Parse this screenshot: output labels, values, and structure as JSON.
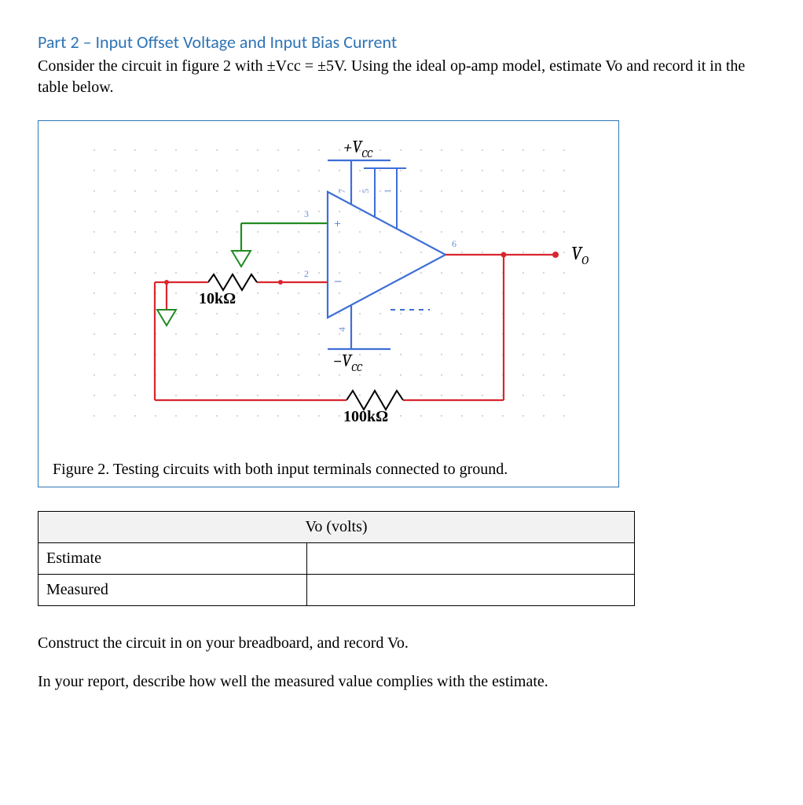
{
  "heading": "Part 2 – Input Offset Voltage and Input Bias Current",
  "prompt": "Consider the circuit in figure 2 with ±Vcc = ±5V. Using the ideal op-amp model, estimate Vo and record it in the table below.",
  "figure": {
    "labels": {
      "vcc_pos": "+V",
      "vcc_pos_sub": "CC",
      "vcc_neg": "−V",
      "vcc_neg_sub": "CC",
      "vo": "V",
      "vo_sub": "O",
      "r1": "10kΩ",
      "r2": "100kΩ",
      "pin_plus": "+",
      "pin_minus": "−",
      "pin2": "2",
      "pin3": "3",
      "pin4": "4",
      "pin5": "5",
      "pin6": "6",
      "pin7": "7",
      "pin1": "1"
    },
    "caption": "Figure 2. Testing circuits with both input terminals connected to ground."
  },
  "table": {
    "header": "Vo (volts)",
    "rows": [
      {
        "label": "Estimate",
        "value": ""
      },
      {
        "label": "Measured",
        "value": ""
      }
    ]
  },
  "instructions": {
    "line1": "Construct the circuit in on your breadboard, and record Vo.",
    "line2": "In your report, describe how well the measured value complies with the estimate."
  }
}
